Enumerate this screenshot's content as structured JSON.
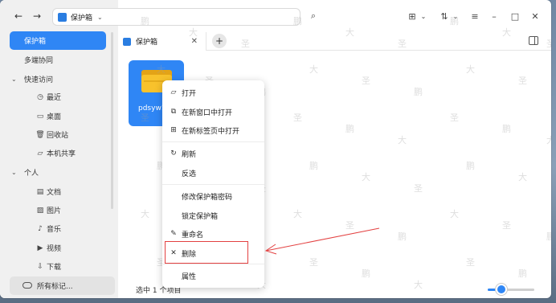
{
  "window": {
    "title": "保护箱"
  },
  "titlebar": {
    "back_icon": "arrow-left-icon",
    "forward_icon": "arrow-right-icon",
    "address": "保护箱",
    "address_icon": "vault-icon",
    "search_icon": "search-icon",
    "view_icon": "grid-view-icon",
    "sort_icon": "sort-icon",
    "menu_icon": "hamburger-menu-icon",
    "min_icon": "minimize-icon",
    "max_icon": "maximize-icon",
    "close_icon": "close-icon"
  },
  "sidebar": {
    "items": [
      {
        "label": "保护箱",
        "active": true
      },
      {
        "label": "多端协同"
      },
      {
        "label": "快速访问",
        "group": true
      },
      {
        "label": "最近",
        "icon": "clock-icon"
      },
      {
        "label": "桌面",
        "icon": "desktop-icon"
      },
      {
        "label": "回收站",
        "icon": "trash-icon"
      },
      {
        "label": "本机共享",
        "icon": "folder-icon"
      },
      {
        "label": "个人",
        "group": true
      },
      {
        "label": "文档",
        "icon": "document-icon"
      },
      {
        "label": "图片",
        "icon": "image-icon"
      },
      {
        "label": "音乐",
        "icon": "music-icon"
      },
      {
        "label": "视频",
        "icon": "video-icon"
      },
      {
        "label": "下载",
        "icon": "download-icon"
      }
    ],
    "bottom_label": "所有标记..."
  },
  "tabs": [
    {
      "label": "保护箱"
    }
  ],
  "content": {
    "files": [
      {
        "name": "pdsyw1"
      }
    ]
  },
  "context_menu": {
    "items": [
      {
        "label": "打开",
        "icon": "folder-open-icon"
      },
      {
        "label": "在新窗口中打开",
        "icon": "new-window-icon"
      },
      {
        "label": "在新标签页中打开",
        "icon": "new-tab-icon"
      },
      {
        "label": "刷新",
        "icon": "refresh-icon"
      },
      {
        "label": "反选",
        "icon": ""
      },
      {
        "label": "修改保护箱密码",
        "icon": ""
      },
      {
        "label": "锁定保护箱",
        "icon": ""
      },
      {
        "label": "重命名",
        "icon": "pencil-icon"
      },
      {
        "label": "删除",
        "icon": "x-icon"
      },
      {
        "label": "属性",
        "icon": ""
      }
    ]
  },
  "statusbar": {
    "text": "选中 1 个项目",
    "zoom_fraction": 0.2
  },
  "watermark": {
    "chars": [
      "鹏",
      "大",
      "圣"
    ]
  },
  "annotation": {
    "color": "#e34141"
  }
}
